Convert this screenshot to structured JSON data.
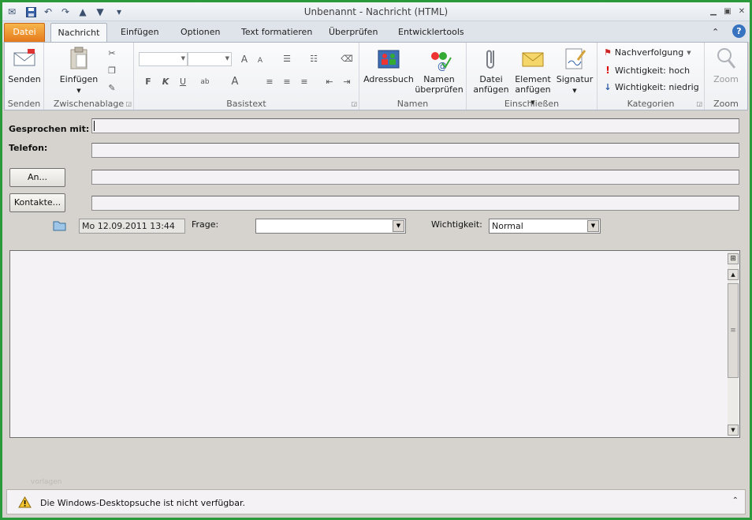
{
  "window": {
    "title": "Unbenannt  -  Nachricht (HTML)"
  },
  "tabs": [
    {
      "label": "Datei"
    },
    {
      "label": "Nachricht"
    },
    {
      "label": "Einfügen"
    },
    {
      "label": "Optionen"
    },
    {
      "label": "Text formatieren"
    },
    {
      "label": "Überprüfen"
    },
    {
      "label": "Entwicklertools"
    }
  ],
  "ribbon": {
    "senden": {
      "button": "Senden",
      "group": "Senden"
    },
    "zwischenablage": {
      "button": "Einfügen",
      "group": "Zwischenablage"
    },
    "basistext": {
      "group": "Basistext",
      "bold": "F",
      "italic": "K",
      "underline": "U"
    },
    "namen": {
      "adressbuch": "Adressbuch",
      "check_line1": "Namen",
      "check_line2": "überprüfen",
      "group": "Namen"
    },
    "einschliessen": {
      "datei_line1": "Datei",
      "datei_line2": "anfügen",
      "element_line1": "Element",
      "element_line2": "anfügen",
      "signatur": "Signatur",
      "group": "Einschließen"
    },
    "kategorien": {
      "nachverfolgung": "Nachverfolgung",
      "hoch": "Wichtigkeit: hoch",
      "niedrig": "Wichtigkeit: niedrig",
      "group": "Kategorien"
    },
    "zoom": {
      "button": "Zoom",
      "group": "Zoom"
    }
  },
  "form": {
    "gesprochen_label": "Gesprochen mit:",
    "telefon_label": "Telefon:",
    "an_button": "An...",
    "kontakte_button": "Kontakte...",
    "date_value": "Mo 12.09.2011 13:44",
    "frage_label": "Frage:",
    "wichtigkeit_label": "Wichtigkeit:",
    "wichtigkeit_value": "Normal"
  },
  "status": {
    "message": "Die Windows-Desktopsuche ist nicht verfügbar.",
    "watermark": "vorlagen"
  },
  "colors": {
    "file_tab": "#e57a1c",
    "frame": "#2a9a3a",
    "help": "#3873c0"
  }
}
